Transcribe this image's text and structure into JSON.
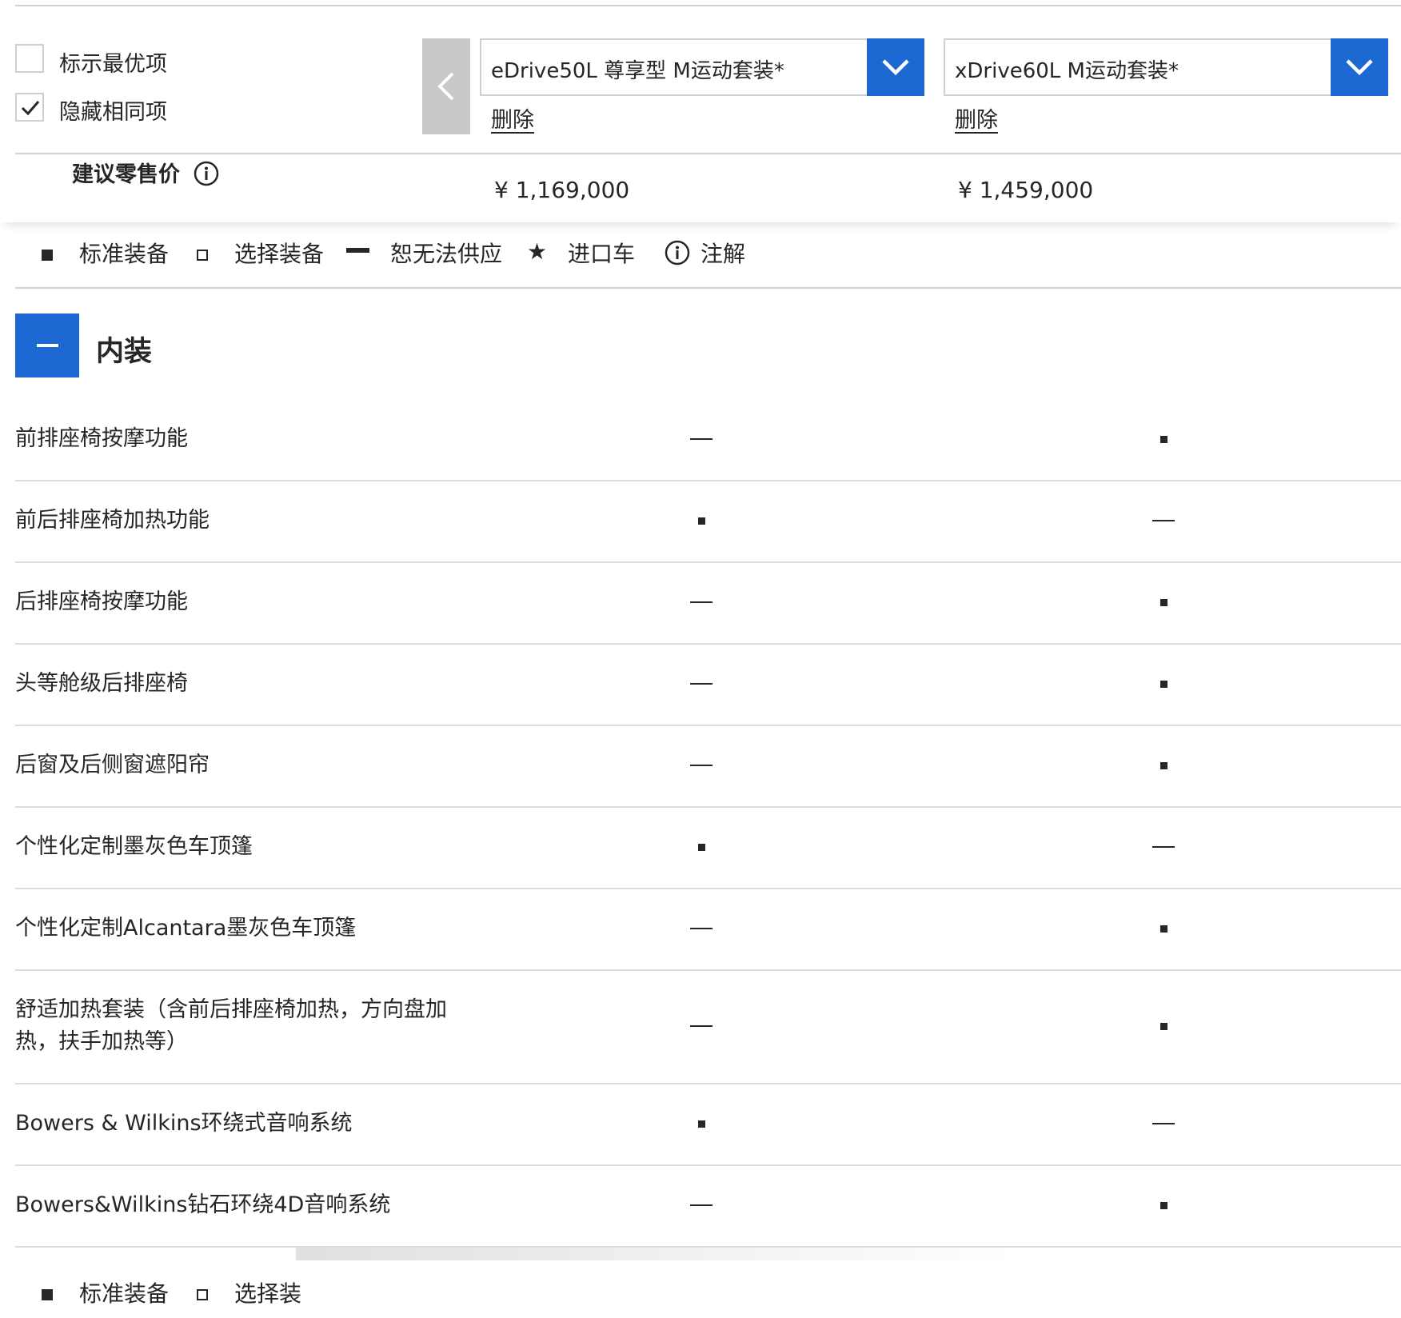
{
  "header": {
    "options": [
      {
        "label": "标示最优项",
        "checked": false
      },
      {
        "label": "隐藏相同项",
        "checked": true
      }
    ],
    "models": [
      {
        "name": "eDrive50L 尊享型 M运动套装*",
        "delete_label": "删除",
        "price": "¥ 1,169,000"
      },
      {
        "name": "xDrive60L M运动套装*",
        "delete_label": "删除",
        "price": "¥ 1,459,000"
      }
    ],
    "msrp_label": "建议零售价",
    "accent_color": "#1c69d4"
  },
  "legend": {
    "standard": "标准装备",
    "optional": "选择装备",
    "unavailable": "恕无法供应",
    "imported": "进口车",
    "note": "注解"
  },
  "legend_bottom": {
    "standard": "标准装备",
    "optional_partial": "选择装"
  },
  "section": {
    "title": "内装",
    "expanded": true,
    "rows": [
      {
        "name": "前排座椅按摩功能",
        "values": [
          "unavailable",
          "standard"
        ]
      },
      {
        "name": "前后排座椅加热功能",
        "values": [
          "standard",
          "unavailable"
        ]
      },
      {
        "name": "后排座椅按摩功能",
        "values": [
          "unavailable",
          "standard"
        ]
      },
      {
        "name": "头等舱级后排座椅",
        "values": [
          "unavailable",
          "standard"
        ]
      },
      {
        "name": "后窗及后侧窗遮阳帘",
        "values": [
          "unavailable",
          "standard"
        ]
      },
      {
        "name": "个性化定制墨灰色车顶篷",
        "values": [
          "standard",
          "unavailable"
        ]
      },
      {
        "name": "个性化定制Alcantara墨灰色车顶篷",
        "values": [
          "unavailable",
          "standard"
        ]
      },
      {
        "name": "舒适加热套装（含前后排座椅加热，方向盘加热，扶手加热等）",
        "values": [
          "unavailable",
          "standard"
        ]
      },
      {
        "name": "Bowers & Wilkins环绕式音响系统",
        "values": [
          "standard",
          "unavailable"
        ]
      },
      {
        "name": "Bowers&Wilkins钻石环绕4D音响系统",
        "values": [
          "unavailable",
          "standard"
        ]
      }
    ]
  }
}
